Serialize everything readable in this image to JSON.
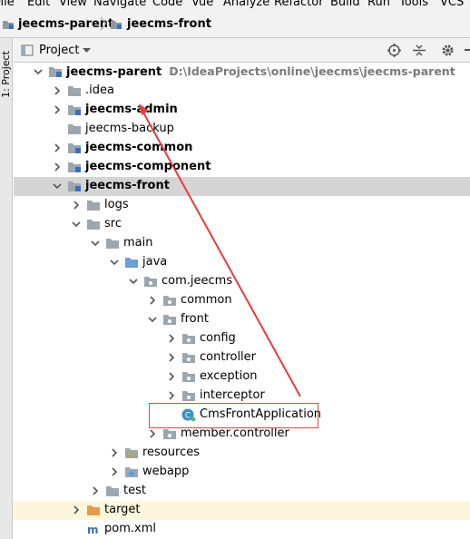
{
  "menu": [
    "File",
    "Edit",
    "View",
    "Navigate",
    "Code",
    "Vue",
    "Analyze",
    "Refactor",
    "Build",
    "Run",
    "Tools",
    "VCS"
  ],
  "breadcrumb": [
    "jeecms-parent",
    "jeecms-front"
  ],
  "tool_window": {
    "side_tab": "1: Project",
    "title": "Project"
  },
  "tree": [
    {
      "label": "jeecms-parent",
      "path": "D:\\IdeaProjects\\online\\jeecms\\jeecms-parent"
    },
    {
      "label": ".idea"
    },
    {
      "label": "jeecms-admin"
    },
    {
      "label": "jeecms-backup"
    },
    {
      "label": "jeecms-common"
    },
    {
      "label": "jeecms-component"
    },
    {
      "label": "jeecms-front"
    },
    {
      "label": "logs"
    },
    {
      "label": "src"
    },
    {
      "label": "main"
    },
    {
      "label": "java"
    },
    {
      "label": "com.jeecms"
    },
    {
      "label": "common"
    },
    {
      "label": "front"
    },
    {
      "label": "config"
    },
    {
      "label": "controller"
    },
    {
      "label": "exception"
    },
    {
      "label": "interceptor"
    },
    {
      "label": "CmsFrontApplication"
    },
    {
      "label": "member.controller"
    },
    {
      "label": "resources"
    },
    {
      "label": "webapp"
    },
    {
      "label": "test"
    },
    {
      "label": "target"
    },
    {
      "label": "pom.xml"
    }
  ]
}
